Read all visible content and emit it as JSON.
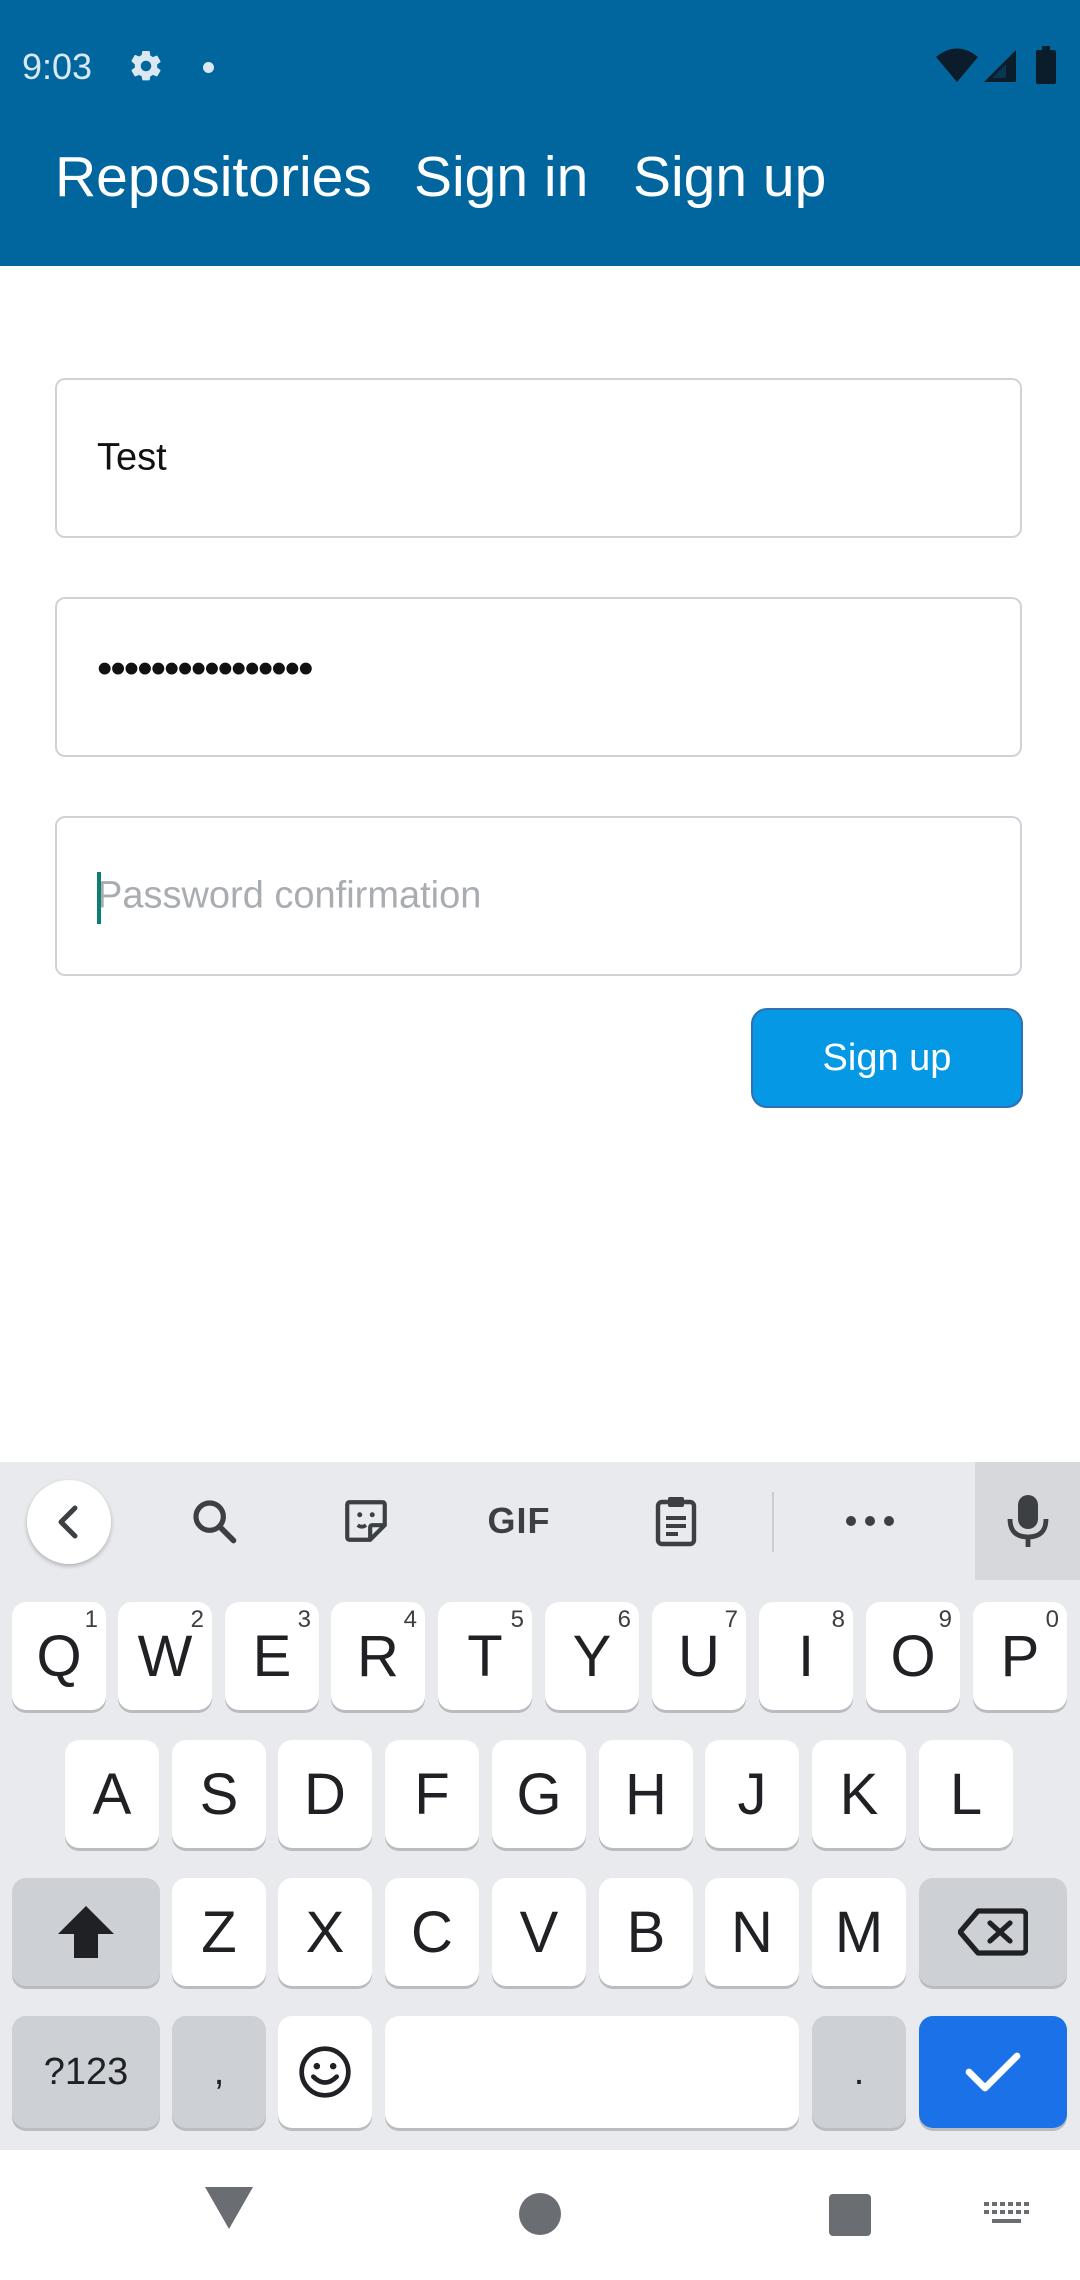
{
  "status_bar": {
    "time": "9:03",
    "icons": [
      "gear-icon",
      "notification-dot",
      "wifi-icon",
      "signal-icon",
      "battery-icon"
    ]
  },
  "app_bar": {
    "links": [
      "Repositories",
      "Sign in",
      "Sign up"
    ],
    "color": "#01669e"
  },
  "form": {
    "username_value": "Test",
    "password_value": "••••••••••••••••",
    "confirm_placeholder": "Password confirmation",
    "submit_label": "Sign up",
    "button_color": "#0598e5"
  },
  "keyboard": {
    "toolbar": [
      "back-icon",
      "search-icon",
      "sticker-icon",
      "GIF",
      "clipboard-icon",
      "more-icon",
      "mic-icon"
    ],
    "row1": [
      {
        "label": "Q",
        "hint": "1"
      },
      {
        "label": "W",
        "hint": "2"
      },
      {
        "label": "E",
        "hint": "3"
      },
      {
        "label": "R",
        "hint": "4"
      },
      {
        "label": "T",
        "hint": "5"
      },
      {
        "label": "Y",
        "hint": "6"
      },
      {
        "label": "U",
        "hint": "7"
      },
      {
        "label": "I",
        "hint": "8"
      },
      {
        "label": "O",
        "hint": "9"
      },
      {
        "label": "P",
        "hint": "0"
      }
    ],
    "row2": [
      "A",
      "S",
      "D",
      "F",
      "G",
      "H",
      "J",
      "K",
      "L"
    ],
    "row3": [
      "Z",
      "X",
      "C",
      "V",
      "B",
      "N",
      "M"
    ],
    "row4": {
      "symbols": "?123",
      "comma": ",",
      "period": "."
    },
    "enter_color": "#1b72e8"
  },
  "nav_bar": {
    "icons": [
      "back-triangle-icon",
      "home-circle-icon",
      "recents-square-icon",
      "keyboard-switch-icon"
    ]
  }
}
